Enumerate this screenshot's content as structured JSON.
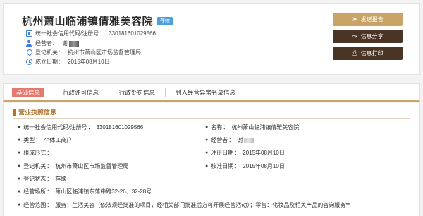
{
  "header": {
    "company_name": "杭州萧山临浦镇倩雅美容院",
    "status_tag": "存续",
    "credit_code_label": "统一社会信用代码/注册号：",
    "credit_code_value": "330181601029566",
    "operator_label": "经营者：",
    "operator_value": "谢",
    "authority_label": "登记机关：",
    "authority_value": "杭州市萧山区市场监督管理局",
    "established_label": "成立日期：",
    "established_value": "2015年08月10日"
  },
  "actions": {
    "send_report": "发送报告",
    "share_info": "信息分享",
    "print_info": "信息打印"
  },
  "tabs": [
    {
      "label": "基础信息",
      "active": true
    },
    {
      "label": "行政许可信息",
      "active": false
    },
    {
      "label": "行政处罚信息",
      "active": false
    },
    {
      "label": "列入经营异常名录信息",
      "active": false
    }
  ],
  "license": {
    "section_title": "营业执照信息",
    "fields": {
      "credit_code": {
        "label": "统一社会信用代码/注册号",
        "value": "330181601029566"
      },
      "name": {
        "label": "名称",
        "value": "杭州萧山临浦镇倩雅美容院"
      },
      "type": {
        "label": "类型",
        "value": "个体工商户"
      },
      "operator": {
        "label": "经营者",
        "value": "谢"
      },
      "form": {
        "label": "组成形式",
        "value": ""
      },
      "reg_date": {
        "label": "注册日期",
        "value": "2015年08月10日"
      },
      "authority": {
        "label": "登记机关",
        "value": "杭州市萧山区市场监督管理局"
      },
      "approval_date": {
        "label": "核准日期",
        "value": "2015年08月10日"
      },
      "status": {
        "label": "登记状态",
        "value": "存续"
      },
      "premises": {
        "label": "经营场所",
        "value": "萧山区临浦镇东藩中路32-26、32-28号"
      },
      "scope": {
        "label": "经营范围",
        "value": "服务：生活美容（依法须经批准的项目，经相关部门批准后方可开展经营活动）；零售：化妆品及相关产品的咨询服务**"
      }
    }
  }
}
